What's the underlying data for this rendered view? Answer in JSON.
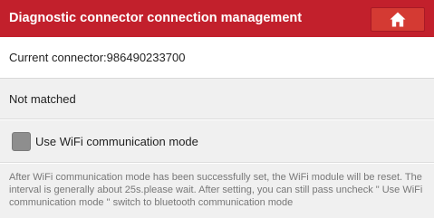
{
  "header": {
    "title": "Diagnostic connector connection management",
    "home_icon": "home-icon",
    "background_color": "#c2202c"
  },
  "connector": {
    "label": "Current connector:986490233700"
  },
  "status": {
    "text": "Not matched"
  },
  "wifi_option": {
    "label": "Use WiFi communication mode",
    "checked": false
  },
  "description": {
    "text": "After WiFi communication mode has been successfully set, the WiFi module will be reset. The interval is generally about 25s.please wait. After setting, you can still pass uncheck \" Use WiFi communication mode \" switch to bluetooth communication mode"
  }
}
